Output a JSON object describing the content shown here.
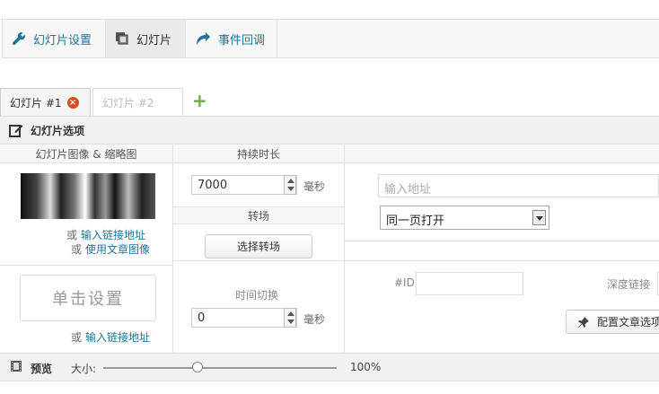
{
  "topnav": {
    "tabs": [
      {
        "label": "幻灯片设置",
        "icon": "wrench-icon"
      },
      {
        "label": "幻灯片",
        "icon": "slides-icon"
      },
      {
        "label": "事件回调",
        "icon": "redo-arrow-icon"
      }
    ]
  },
  "slide_tabs": [
    {
      "label": "幻灯片 #1",
      "active": true
    },
    {
      "label": "幻灯片 #2",
      "active": false
    }
  ],
  "add_tab": "+",
  "panel": {
    "title": "幻灯片选项",
    "image_col": {
      "title": "幻灯片图像 & 缩略图",
      "or": "或",
      "link1": "输入链接地址",
      "link2": "使用文章图像",
      "click_setup": "单击设置",
      "link3": "输入链接地址"
    },
    "duration": {
      "title": "持续时长",
      "value": "7000",
      "unit": "毫秒"
    },
    "transition": {
      "title": "转场",
      "button": "选择转场",
      "time_label": "时间切换",
      "time_value": "0",
      "unit": "毫秒"
    },
    "link": {
      "url_placeholder": "输入地址",
      "target_selected": "同一页打开",
      "id_label": "#ID",
      "deep_link_label": "深度链接",
      "post_button": "配置文章选项"
    }
  },
  "preview": {
    "title": "预览",
    "size_label": "大小:",
    "zoom": "100%",
    "zoom_fraction": 1.0
  }
}
